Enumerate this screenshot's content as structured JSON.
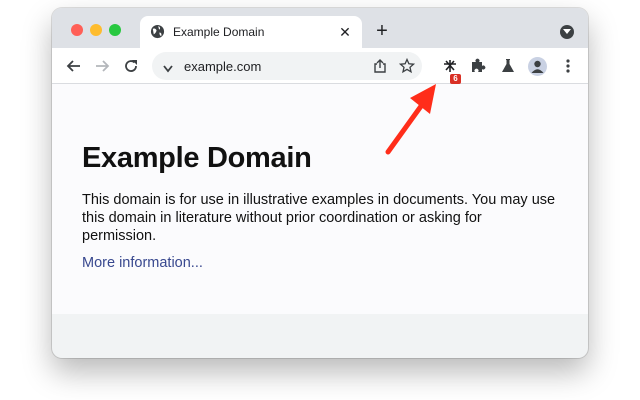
{
  "browser": {
    "tab": {
      "title": "Example Domain",
      "favicon": "globe-icon",
      "close_label": "✕"
    },
    "new_tab_label": "+",
    "url": "example.com",
    "extension_badge_count": "6",
    "icons": [
      "back-icon",
      "forward-icon",
      "reload-icon",
      "chevron-down-icon",
      "share-icon",
      "star-icon",
      "extension-icon",
      "puzzle-icon",
      "flask-icon",
      "avatar-icon",
      "kebab-menu-icon",
      "tab-search-icon"
    ]
  },
  "page": {
    "title": "Example Domain",
    "paragraph": "This domain is for use in illustrative examples in documents. You may use this domain in literature without prior coordination or asking for permission.",
    "link_text": "More information..."
  },
  "annotation": {
    "arrow_color": "#ff2d1a",
    "points_to": "extension-icon"
  },
  "colors": {
    "tab_strip": "#dee1e6",
    "badge": "#d93025",
    "link": "#38488f"
  }
}
